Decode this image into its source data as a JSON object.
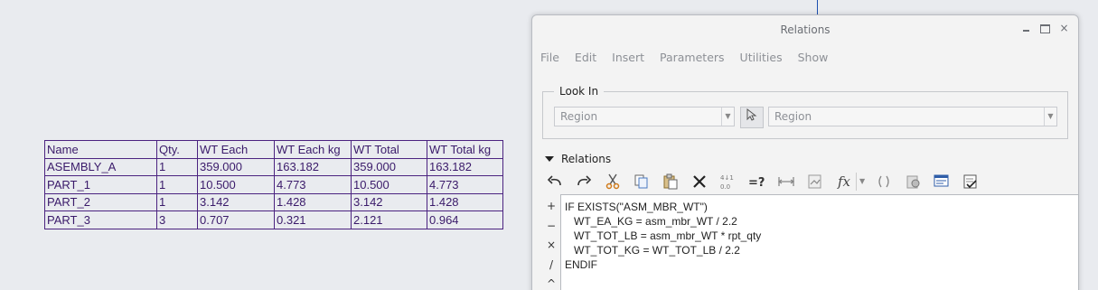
{
  "table": {
    "header": [
      "Name",
      "Qty.",
      "WT Each",
      "WT Each kg",
      "WT Total",
      "WT Total kg"
    ],
    "rows": [
      [
        "ASEMBLY_A",
        "1",
        "359.000",
        "163.182",
        "359.000",
        "163.182"
      ],
      [
        "PART_1",
        "1",
        "10.500",
        "4.773",
        "10.500",
        "4.773"
      ],
      [
        "PART_2",
        "1",
        "3.142",
        "1.428",
        "3.142",
        "1.428"
      ],
      [
        "PART_3",
        "3",
        "0.707",
        "0.321",
        "2.121",
        "0.964"
      ]
    ]
  },
  "dialog": {
    "title": "Relations",
    "menu": [
      "File",
      "Edit",
      "Insert",
      "Parameters",
      "Utilities",
      "Show"
    ],
    "look_in": {
      "legend": "Look In",
      "type_value": "Region",
      "item_value": "Region"
    },
    "relations_label": "Relations",
    "toolbar_icons": [
      "undo-icon",
      "redo-icon",
      "cut-icon",
      "copy-icon",
      "paste-icon",
      "delete-icon",
      "sort-icon",
      "evaluate-icon",
      "show-units-icon",
      "verify-icon",
      "function-icon",
      "parentheses-icon",
      "parameters-icon",
      "local-parameters-icon",
      "execute-verify-icon"
    ],
    "operators": [
      "+",
      "−",
      "×",
      "/",
      "^"
    ],
    "code": [
      "IF EXISTS(\"ASM_MBR_WT\")",
      "   WT_EA_KG = asm_mbr_WT / 2.2",
      "   WT_TOT_LB = asm_mbr_WT * rpt_qty",
      "   WT_TOT_KG = WT_TOT_LB / 2.2",
      "ENDIF"
    ],
    "window_controls": [
      "–",
      "□",
      "×"
    ]
  }
}
